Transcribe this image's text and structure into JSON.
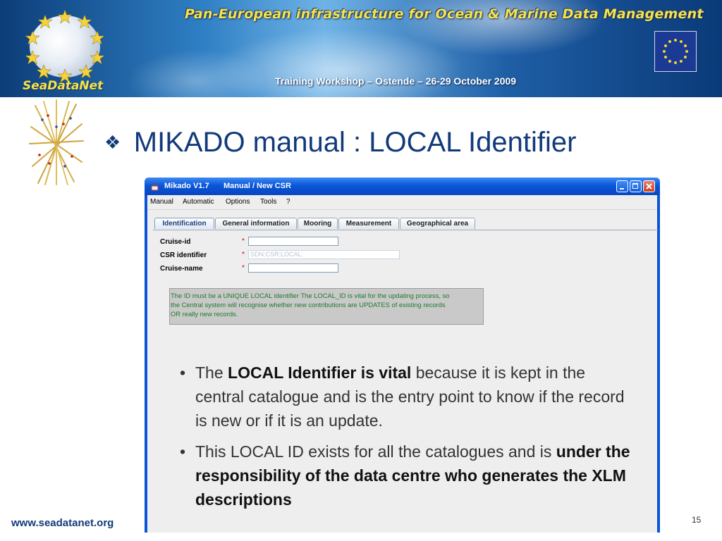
{
  "banner": {
    "title": "Pan-European infrastructure for Ocean & Marine Data Management",
    "workshop": "Training Workshop – Ostende – 26-29 October 2009",
    "logo_text": "SeaDataNet"
  },
  "slide": {
    "title": "MIKADO manual : LOCAL Identifier",
    "title_bullet": "❖",
    "footer_url": "www.seadatanet.org",
    "page_number": "15"
  },
  "window": {
    "app_title": "Mikado V1.7",
    "doc_title": "Manual / New CSR",
    "menu": [
      "Manual",
      "Automatic",
      "Options",
      "Tools",
      "?"
    ],
    "tabs": [
      "Identification",
      "General information",
      "Mooring",
      "Measurement",
      "Geographical area"
    ],
    "active_tab": "Identification",
    "fields": [
      {
        "label": "Cruise-id",
        "required": "*",
        "value": ""
      },
      {
        "label": "CSR identifier",
        "required": "*",
        "value": "SDN:CSR:LOCAL:"
      },
      {
        "label": "Cruise-name",
        "required": "*",
        "value": ""
      }
    ],
    "info_lines": [
      "The ID must be a UNIQUE LOCAL identifier The LOCAL_ID is vital for the updating process, so",
      "the Central system will recognise whether new contributions are UPDATES of existing records",
      "OR really new records."
    ]
  },
  "bullets": [
    {
      "pre": "The ",
      "bold": "LOCAL Identifier is vital",
      "post": " because it is kept in the central catalogue and is the entry point to know if the record is new or if it is an update."
    },
    {
      "pre": "This LOCAL ID exists for all the catalogues and is ",
      "bold": "under the responsibility of the data centre who generates the XLM  descriptions",
      "post": ""
    }
  ],
  "colors": {
    "title_blue": "#123a7a",
    "banner_yellow": "#f4e44a",
    "xp_blue": "#0a55d6",
    "info_green": "#1f7a2a",
    "required_red": "#d60000"
  }
}
